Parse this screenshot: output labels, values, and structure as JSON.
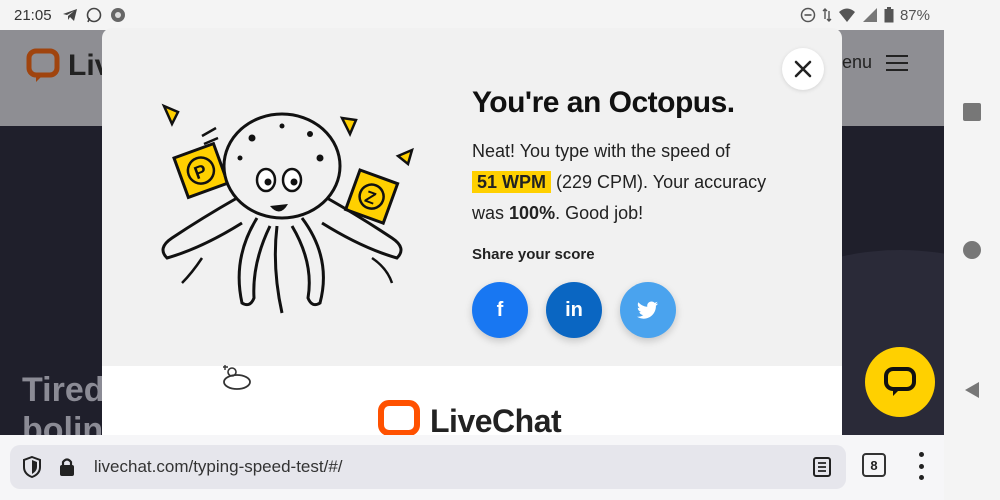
{
  "status_bar": {
    "time": "21:05",
    "battery": "87%",
    "left_icons": [
      "telegram-icon",
      "whatsapp-icon",
      "app-icon"
    ],
    "right_icons": [
      "dnd-icon",
      "data-icon",
      "wifi-icon",
      "signal-icon",
      "battery-icon"
    ]
  },
  "background_page": {
    "logo_text": "Liv",
    "menu_label": "enu",
    "hero_text_line1": "Tired",
    "hero_text_line2": "bolin"
  },
  "modal": {
    "heading": "You're an Octopus.",
    "result_prefix": "Neat! You type with the speed of",
    "wpm": "51 WPM",
    "cpm_text": "(229 CPM). Your accuracy",
    "accuracy_prefix": "was",
    "accuracy": "100%",
    "accuracy_suffix": ". Good job!",
    "share_label": "Share your score",
    "share_buttons": [
      {
        "label": "f",
        "icon": "facebook-icon",
        "color": "#1877f2"
      },
      {
        "label": "in",
        "icon": "linkedin-icon",
        "color": "#0a66c2"
      },
      {
        "label": "twitter",
        "icon": "twitter-icon",
        "color": "#4aa3ee"
      }
    ],
    "footer_logo_text": "LiveChat",
    "brand_color": "#ff5100",
    "highlight_color": "#ffd000"
  },
  "browser": {
    "url": "livechat.com/typing-speed-test/#/",
    "tab_count": "8"
  }
}
